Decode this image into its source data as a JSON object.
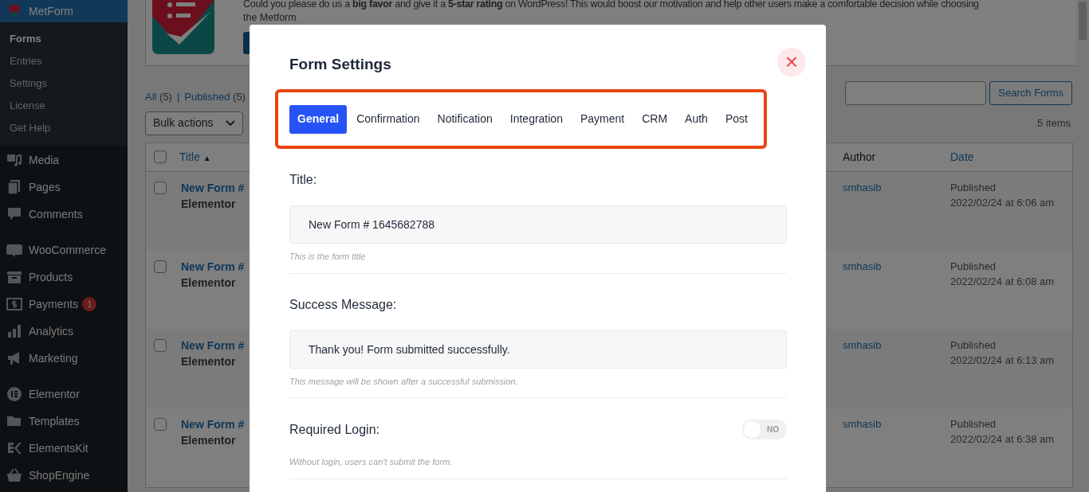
{
  "sidebar": {
    "plugin": {
      "label": "MetForm",
      "selected": true
    },
    "submenu": [
      {
        "label": "Forms",
        "selected": true
      },
      {
        "label": "Entries",
        "selected": false
      },
      {
        "label": "Settings",
        "selected": false
      },
      {
        "label": "License",
        "selected": false
      },
      {
        "label": "Get Help",
        "selected": false
      }
    ],
    "groups": [
      [
        {
          "label": "Media"
        },
        {
          "label": "Pages"
        },
        {
          "label": "Comments"
        }
      ],
      [
        {
          "label": "WooCommerce"
        },
        {
          "label": "Products"
        },
        {
          "label": "Payments",
          "badge": "1"
        },
        {
          "label": "Analytics"
        },
        {
          "label": "Marketing"
        }
      ],
      [
        {
          "label": "Elementor"
        },
        {
          "label": "Templates"
        },
        {
          "label": "ElementsKit"
        },
        {
          "label": "ShopEngine"
        }
      ]
    ]
  },
  "banner": {
    "message": "Could you please do us a **big favor** and give it a **5-star rating** on WordPress! This would boost our motivation and help other users make a comfortable decision while choosing",
    "message_end": "the Metform"
  },
  "filter_separator": "|",
  "filters": [
    {
      "label": "All",
      "count": "(5)"
    },
    {
      "label": "Published",
      "count": "(5)"
    }
  ],
  "bulk_actions": "Bulk actions",
  "search_button": "Search Forms",
  "items_count": "5 items",
  "table": {
    "select_all_checked": false,
    "columns": [
      "Title",
      "Author",
      "Date"
    ],
    "sort_mark": "▲",
    "rows": [
      {
        "checked": false,
        "title": "New Form #",
        "builder": "Elementor",
        "author": "smhasib",
        "status": "Published",
        "date": "2022/02/24 at 6:06 am"
      },
      {
        "checked": false,
        "title": "New Form #",
        "builder": "Elementor",
        "author": "smhasib",
        "status": "Published",
        "date": "2022/02/24 at 6:08 am"
      },
      {
        "checked": false,
        "title": "New Form #",
        "builder": "Elementor",
        "author": "smhasib",
        "status": "Published",
        "date": "2022/02/24 at 6:13 am"
      },
      {
        "checked": false,
        "title": "New Form #",
        "builder": "Elementor",
        "author": "smhasib",
        "status": "Published",
        "date": "2022/02/24 at 6:38 am"
      }
    ]
  },
  "modal": {
    "title": "Form Settings",
    "close": "×",
    "tabs": [
      {
        "label": "General",
        "selected": true
      },
      {
        "label": "Confirmation",
        "selected": false
      },
      {
        "label": "Notification",
        "selected": false
      },
      {
        "label": "Integration",
        "selected": false
      },
      {
        "label": "Payment",
        "selected": false
      },
      {
        "label": "CRM",
        "selected": false
      },
      {
        "label": "Auth",
        "selected": false
      },
      {
        "label": "Post",
        "selected": false
      }
    ],
    "fields": [
      {
        "kind": "text",
        "label": "Title:",
        "value": "New Form # 1645682788",
        "hint": "This is the form title"
      },
      {
        "kind": "text",
        "label": "Success Message:",
        "value": "Thank you! Form submitted successfully.",
        "hint": "This message will be shown after a successful submission."
      },
      {
        "kind": "toggle",
        "label": "Required Login:",
        "on": false,
        "off_text": "NO",
        "hint": "Without login, users can't submit the form."
      }
    ]
  }
}
